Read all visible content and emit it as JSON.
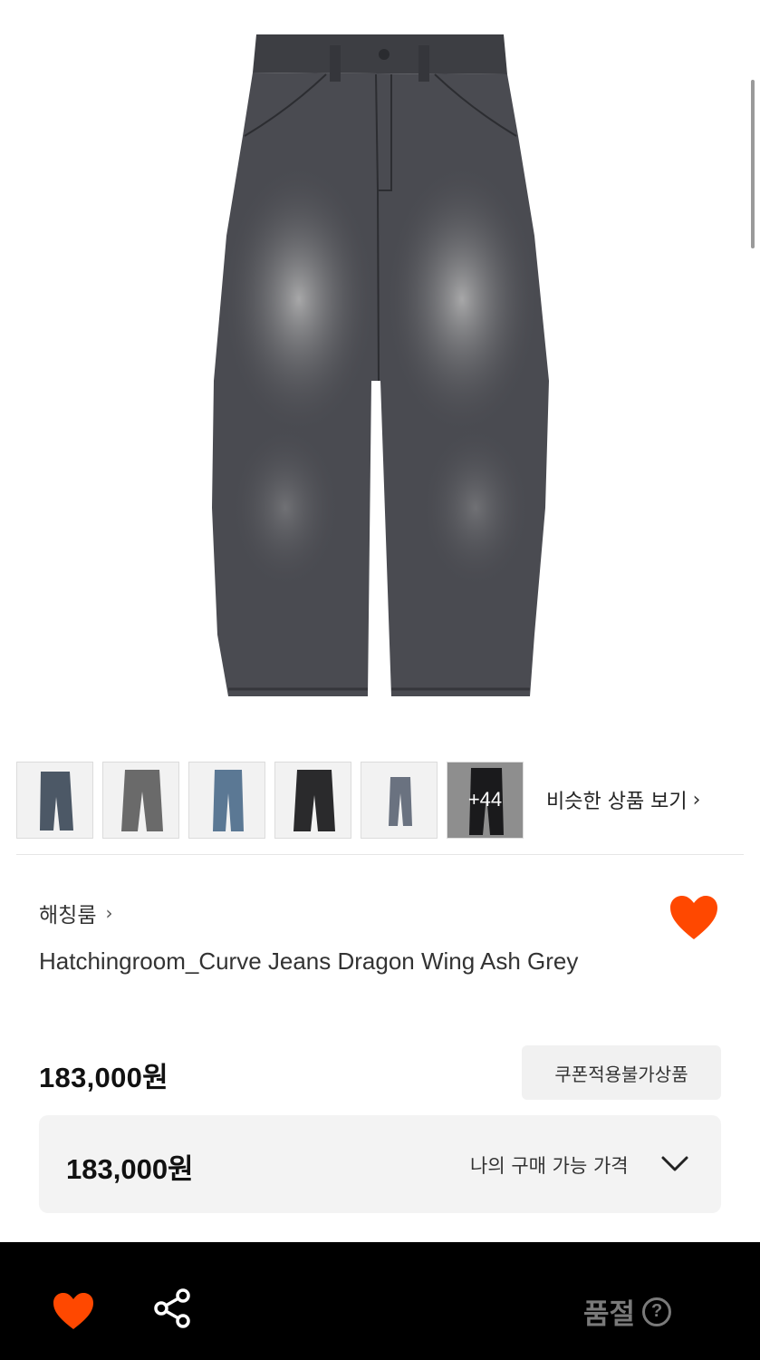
{
  "product": {
    "image_alt": "ash grey curve jeans",
    "brand": "해칭룸",
    "title": "Hatchingroom_Curve Jeans Dragon Wing Ash Grey",
    "price": "183,000원",
    "coupon_badge": "쿠폰적용불가상품",
    "my_price": {
      "amount": "183,000원",
      "label": "나의 구매 가능 가격"
    }
  },
  "similar": {
    "thumbnails": [
      {
        "name": "thumb-1",
        "color": "#4c5866"
      },
      {
        "name": "thumb-2",
        "color": "#6a6a6a"
      },
      {
        "name": "thumb-3",
        "color": "#5b7894"
      },
      {
        "name": "thumb-4",
        "color": "#2a2a2c"
      },
      {
        "name": "thumb-5",
        "color": "#6a7280"
      },
      {
        "name": "thumb-6",
        "color": "#1a1a1c"
      }
    ],
    "more_count": "+44",
    "link_label": "비슷한 상품 보기"
  },
  "bottom_bar": {
    "status": "품절",
    "help_symbol": "?"
  },
  "colors": {
    "accent": "#ff4800",
    "bottom_bar_bg": "#000000",
    "soldout_text": "#7a7a7a"
  },
  "icons": {
    "wishlist": "heart-icon",
    "share": "share-icon",
    "chevron_right": "chevron-right-icon",
    "chevron_down": "chevron-down-icon",
    "help": "question-circle-icon"
  }
}
